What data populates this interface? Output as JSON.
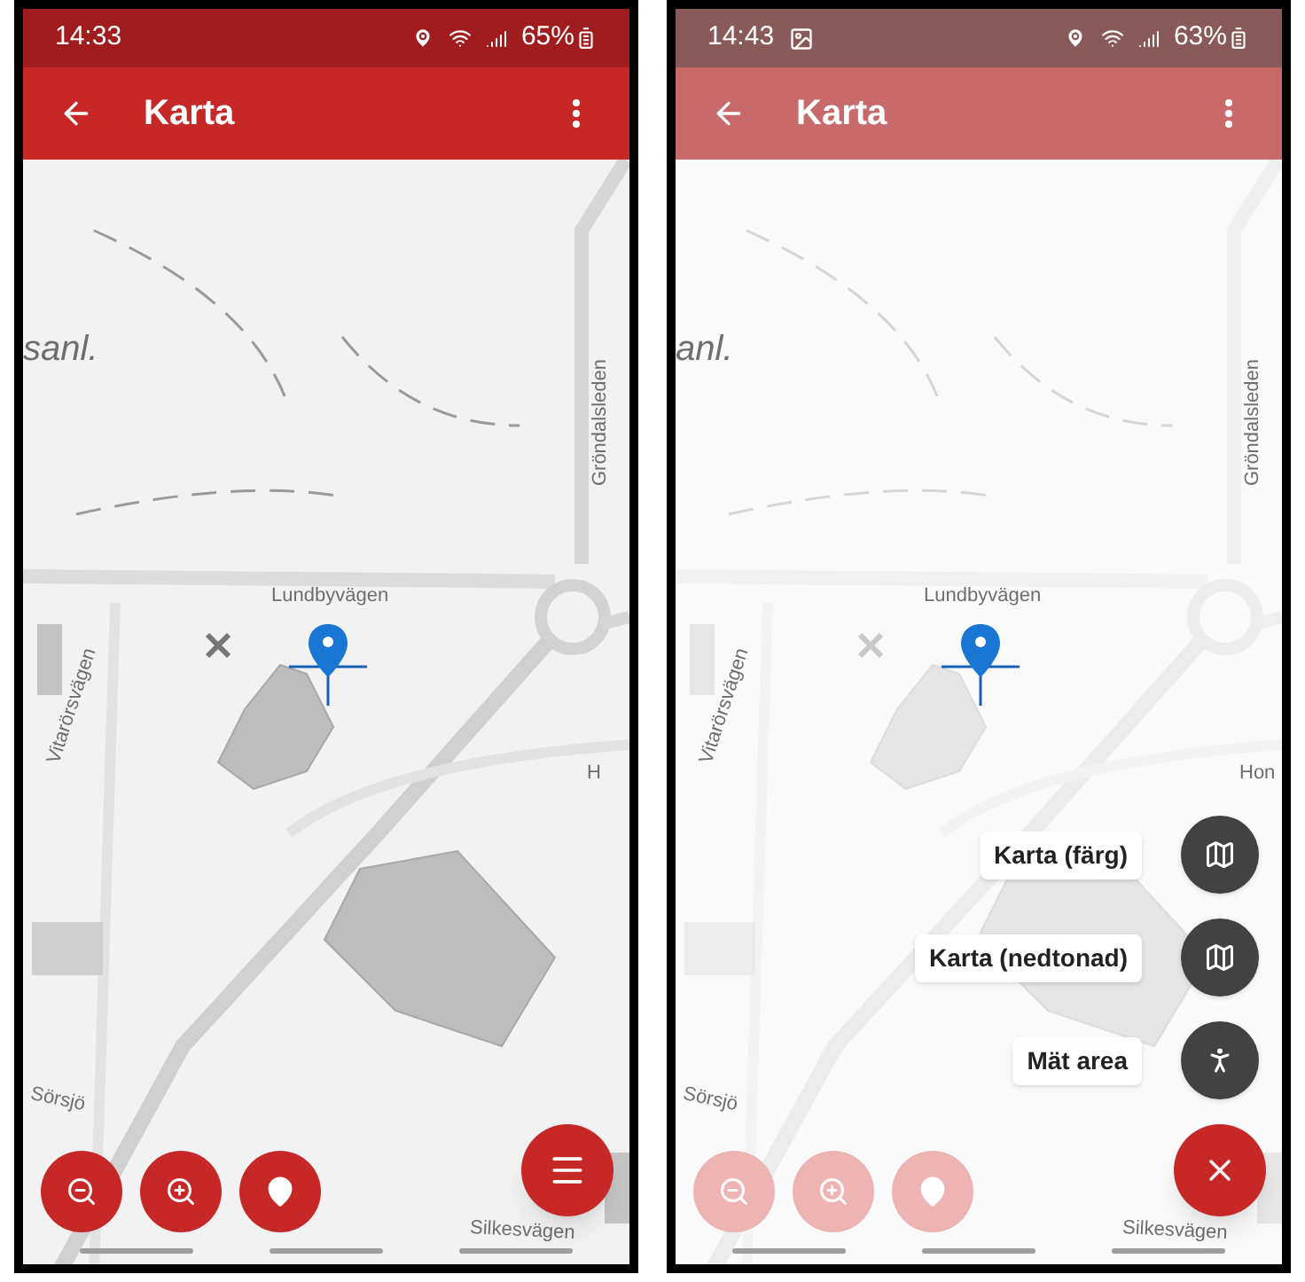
{
  "screens": [
    {
      "status": {
        "time": "14:33",
        "battery": "65%",
        "image_notification": false
      },
      "app_bar": {
        "title": "Karta"
      },
      "dimmed": false,
      "map_labels": [
        {
          "text": "sanl.",
          "kind": "area"
        },
        {
          "text": "Gröndalsleden",
          "kind": "vertical"
        },
        {
          "text": "Lundbyvägen",
          "kind": "road"
        },
        {
          "text": "Vitarörsvägen",
          "kind": "slanted"
        },
        {
          "text": "H",
          "kind": "road"
        },
        {
          "text": "Sörsjö",
          "kind": "road"
        },
        {
          "text": "Silkesvägen",
          "kind": "road"
        }
      ],
      "map_buttons": [
        {
          "kind": "zoom_out"
        },
        {
          "kind": "zoom_in"
        },
        {
          "kind": "location"
        }
      ],
      "fab": {
        "open": false
      }
    },
    {
      "status": {
        "time": "14:43",
        "battery": "63%",
        "image_notification": true
      },
      "app_bar": {
        "title": "Karta"
      },
      "dimmed": true,
      "map_labels": [
        {
          "text": "anl.",
          "kind": "area"
        },
        {
          "text": "Gröndalsleden",
          "kind": "vertical"
        },
        {
          "text": "Lundbyvägen",
          "kind": "road"
        },
        {
          "text": "Vitarörsvägen",
          "kind": "slanted"
        },
        {
          "text": "Hon",
          "kind": "road"
        },
        {
          "text": "Sörsjö",
          "kind": "road"
        },
        {
          "text": "Silkesvägen",
          "kind": "road"
        }
      ],
      "map_buttons": [
        {
          "kind": "zoom_out"
        },
        {
          "kind": "zoom_in"
        },
        {
          "kind": "location"
        }
      ],
      "fab": {
        "open": true
      },
      "fab_menu": [
        {
          "label": "Karta (färg)",
          "kind": "map"
        },
        {
          "label": "Karta (nedtonad)",
          "kind": "map"
        },
        {
          "label": "Mät area",
          "kind": "walk"
        }
      ]
    }
  ]
}
